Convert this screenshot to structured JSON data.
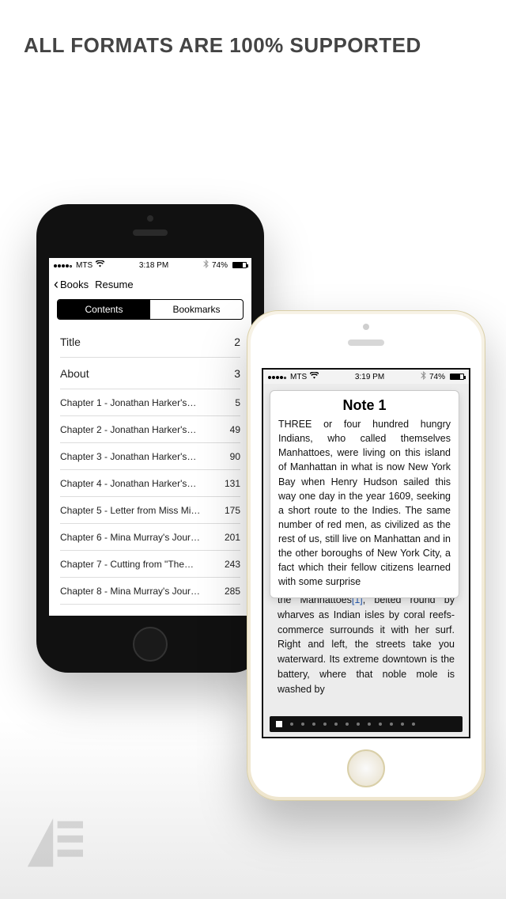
{
  "headline": "ALL FORMATS ARE 100% SUPPORTED",
  "phone1": {
    "status": {
      "carrier": "MTS",
      "time": "3:18 PM",
      "battery": "74%"
    },
    "nav": {
      "back": "Books",
      "action": "Resume"
    },
    "tabs": {
      "contents": "Contents",
      "bookmarks": "Bookmarks"
    },
    "toc": [
      {
        "title": "Title",
        "page": "2"
      },
      {
        "title": "About",
        "page": "3"
      },
      {
        "title": "Chapter 1 - Jonathan Harker's…",
        "page": "5"
      },
      {
        "title": "Chapter 2 - Jonathan Harker's…",
        "page": "49"
      },
      {
        "title": "Chapter 3 - Jonathan Harker's…",
        "page": "90"
      },
      {
        "title": "Chapter 4 - Jonathan Harker's…",
        "page": "131"
      },
      {
        "title": "Chapter 5 - Letter from Miss Mi…",
        "page": "175"
      },
      {
        "title": "Chapter 6 - Mina Murray's Jour…",
        "page": "201"
      },
      {
        "title": "Chapter 7 - Cutting from \"The…",
        "page": "243"
      },
      {
        "title": "Chapter 8 - Mina Murray's Jour…",
        "page": "285"
      }
    ]
  },
  "phone2": {
    "status": {
      "carrier": "MTS",
      "time": "3:19 PM",
      "battery": "74%"
    },
    "note": {
      "title": "Note 1",
      "body": "THREE or four hundred hungry Indians, who called themselves Manhattoes, were living on this island of Manhattan in what is now New York Bay when Henry Hudson sailed this way one day in the year 1609, seeking a short route to the Indies. The same number of red men, as civilized as the rest of us, still live on Manhattan and in the other boroughs of New York City, a fact which their fellow citizens learned with some surprise"
    },
    "tail_pre": "the Manhattoes",
    "tail_ref": "[1]",
    "tail_post": ", belted round by wharves as Indian isles by coral reefs-commerce surrounds it with her surf. Right and left, the streets take you waterward. Its extreme downtown is the battery, where that noble mole is washed by"
  }
}
